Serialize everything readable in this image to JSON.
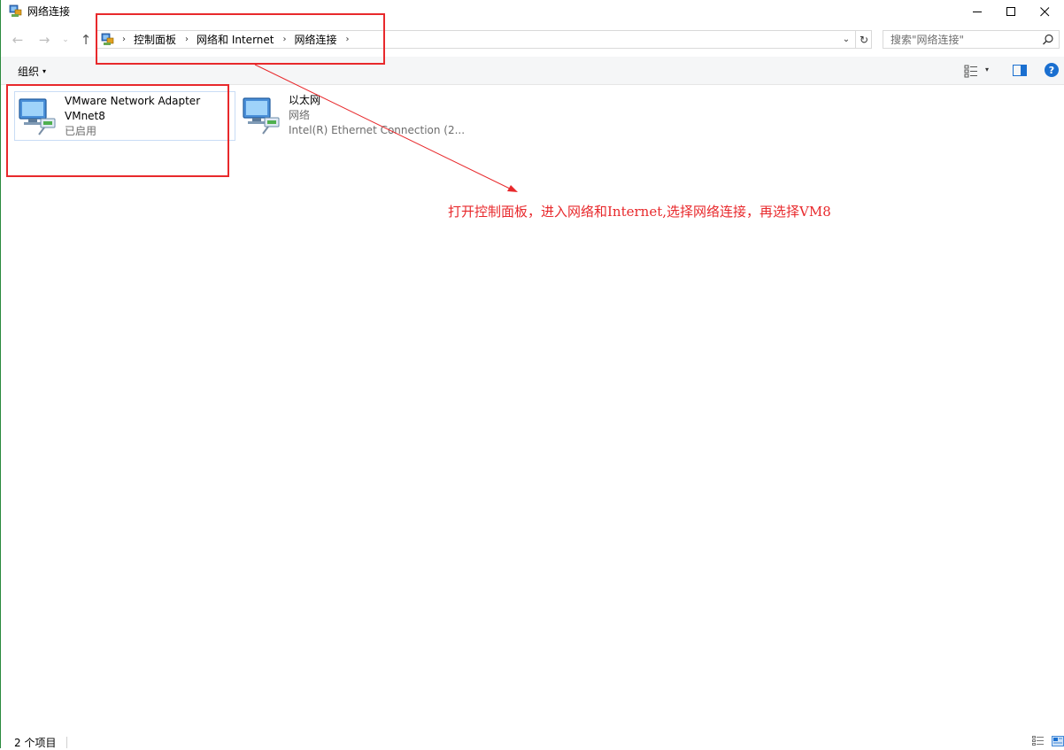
{
  "window": {
    "title": "网络连接",
    "app_icon": "network-connections-icon",
    "controls": {
      "minimize": "—",
      "maximize": "☐",
      "close": "✕"
    }
  },
  "nav": {
    "back": "←",
    "forward": "→",
    "recent": "⌄",
    "up": "↑",
    "breadcrumbs": [
      "控制面板",
      "网络和 Internet",
      "网络连接"
    ],
    "separator": "›",
    "dropdown": "⌄",
    "refresh": "↻",
    "search_placeholder": "搜索\"网络连接\""
  },
  "command_bar": {
    "organize": "组织",
    "caret": "▾"
  },
  "items": [
    {
      "name": "VMware Network Adapter",
      "sub": "VMnet8",
      "status": "已启用",
      "selected": true
    },
    {
      "name": "以太网",
      "sub": "网络",
      "status": "Intel(R) Ethernet Connection (2..."
    }
  ],
  "annotation": {
    "text": "打开控制面板，进入网络和Internet,选择网络连接，再选择VM8",
    "color": "#e8292c"
  },
  "status_bar": {
    "count": "2 个项目"
  }
}
